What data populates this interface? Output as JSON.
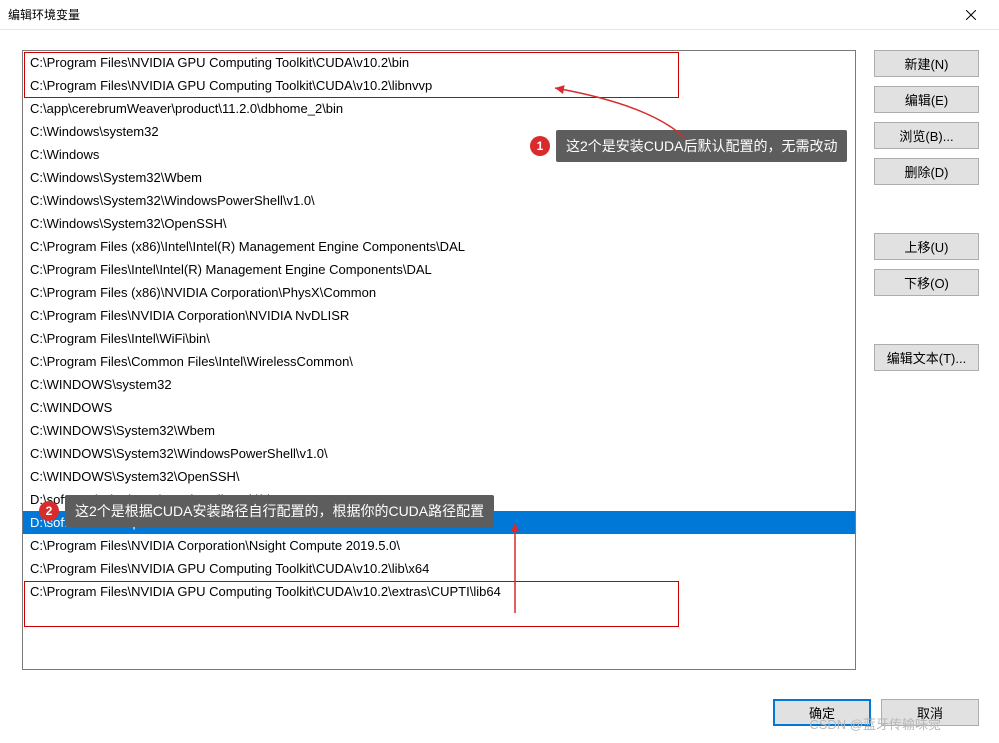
{
  "titlebar": {
    "title": "编辑环境变量"
  },
  "list": {
    "items": [
      "C:\\Program Files\\NVIDIA GPU Computing Toolkit\\CUDA\\v10.2\\bin",
      "C:\\Program Files\\NVIDIA GPU Computing Toolkit\\CUDA\\v10.2\\libnvvp",
      "C:\\app\\cerebrumWeaver\\product\\11.2.0\\dbhome_2\\bin",
      "C:\\Windows\\system32",
      "C:\\Windows",
      "C:\\Windows\\System32\\Wbem",
      "C:\\Windows\\System32\\WindowsPowerShell\\v1.0\\",
      "C:\\Windows\\System32\\OpenSSH\\",
      "C:\\Program Files (x86)\\Intel\\Intel(R) Management Engine Components\\DAL",
      "C:\\Program Files\\Intel\\Intel(R) Management Engine Components\\DAL",
      "C:\\Program Files (x86)\\NVIDIA Corporation\\PhysX\\Common",
      "C:\\Program Files\\NVIDIA Corporation\\NVIDIA NvDLISR",
      "C:\\Program Files\\Intel\\WiFi\\bin\\",
      "C:\\Program Files\\Common Files\\Intel\\WirelessCommon\\",
      "C:\\WINDOWS\\system32",
      "C:\\WINDOWS",
      "C:\\WINDOWS\\System32\\Wbem",
      "C:\\WINDOWS\\System32\\WindowsPowerShell\\v1.0\\",
      "C:\\WINDOWS\\System32\\OpenSSH\\",
      "D:\\software\\other\\SVN\\svn_install_path\\bin",
      "D:\\software\\other\\protoc-21.9-win64\\bin",
      "C:\\Program Files\\NVIDIA Corporation\\Nsight Compute 2019.5.0\\",
      "C:\\Program Files\\NVIDIA GPU Computing Toolkit\\CUDA\\v10.2\\lib\\x64",
      "C:\\Program Files\\NVIDIA GPU Computing Toolkit\\CUDA\\v10.2\\extras\\CUPTI\\lib64"
    ],
    "selected_index": 20
  },
  "sidebar": {
    "new": "新建(N)",
    "edit": "编辑(E)",
    "browse": "浏览(B)...",
    "delete": "删除(D)",
    "move_up": "上移(U)",
    "move_down": "下移(O)",
    "edit_text": "编辑文本(T)..."
  },
  "footer": {
    "ok": "确定",
    "cancel": "取消"
  },
  "callouts": {
    "c1": {
      "num": "1",
      "text": "这2个是安装CUDA后默认配置的，无需改动"
    },
    "c2": {
      "num": "2",
      "text": "这2个是根据CUDA安装路径自行配置的，根据你的CUDA路径配置"
    }
  },
  "watermark": "CSDN @蓝牙传输味觉"
}
